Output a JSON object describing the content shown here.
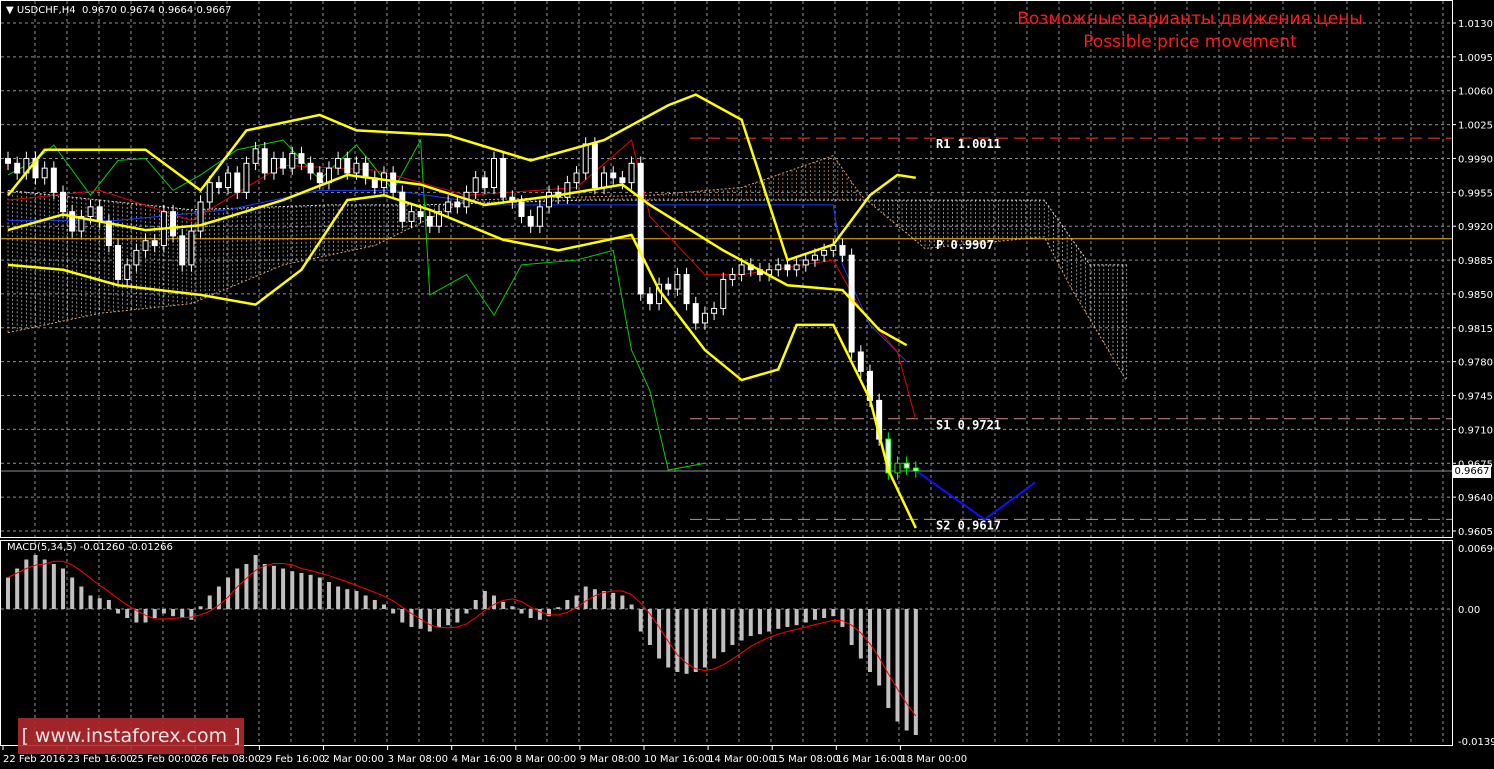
{
  "header": {
    "symbol": "USDCHF,H4",
    "ohlc": "0.9670 0.9674 0.9664 0.9667"
  },
  "annotation": {
    "line1": "Возможные варианты движения цены",
    "line2": "Possible price movement"
  },
  "watermark": "[ www.instaforex.com ]",
  "macd_label": "MACD(5,34,5) -0.01260 -0.01266",
  "current_price": "0.9667",
  "chart_data": [
    {
      "type": "candlestick",
      "symbol": "USDCHF",
      "timeframe": "H4",
      "ylim": [
        0.9605,
        1.013
      ],
      "yticks": [
        "1.0130",
        "1.0095",
        "1.0060",
        "1.0025",
        "0.9990",
        "0.9955",
        "0.9920",
        "0.9885",
        "0.9850",
        "0.9815",
        "0.9780",
        "0.9745",
        "0.9710",
        "0.9675",
        "0.9640",
        "0.9605"
      ],
      "xticks": [
        "22 Feb 2016",
        "23 Feb 16:00",
        "25 Feb 00:00",
        "26 Feb 08:00",
        "29 Feb 16:00",
        "2 Mar 00:00",
        "3 Mar 08:00",
        "4 Mar 16:00",
        "8 Mar 00:00",
        "9 Mar 08:00",
        "10 Mar 16:00",
        "14 Mar 00:00",
        "15 Mar 08:00",
        "16 Mar 16:00",
        "18 Mar 00:00"
      ],
      "close": [
        0.9985,
        0.9975,
        0.999,
        0.997,
        0.998,
        0.9955,
        0.9935,
        0.9915,
        0.993,
        0.994,
        0.9925,
        0.99,
        0.9865,
        0.988,
        0.9895,
        0.9905,
        0.99,
        0.9935,
        0.991,
        0.988,
        0.9915,
        0.9945,
        0.9965,
        0.996,
        0.9975,
        0.9955,
        0.9985,
        1.0,
        0.9975,
        0.999,
        0.998,
        0.9995,
        0.9985,
        0.9975,
        0.9965,
        0.998,
        0.999,
        0.9975,
        0.9985,
        0.997,
        0.996,
        0.9975,
        0.9955,
        0.9925,
        0.9935,
        0.993,
        0.992,
        0.9935,
        0.9945,
        0.994,
        0.9955,
        0.997,
        0.996,
        0.999,
        0.995,
        0.9945,
        0.993,
        0.992,
        0.994,
        0.9955,
        0.995,
        0.9965,
        0.9975,
        1.0005,
        0.996,
        0.9975,
        0.997,
        0.9965,
        0.9985,
        0.985,
        0.984,
        0.986,
        0.9855,
        0.987,
        0.984,
        0.982,
        0.983,
        0.9835,
        0.9865,
        0.987,
        0.988,
        0.9875,
        0.987,
        0.9875,
        0.988,
        0.9875,
        0.988,
        0.9885,
        0.989,
        0.9895,
        0.99,
        0.989,
        0.979,
        0.977,
        0.974,
        0.97,
        0.9665,
        0.9675,
        0.967,
        0.9667
      ],
      "last_ohlc": [
        0.967,
        0.9674,
        0.9664,
        0.9667
      ],
      "bollinger": {
        "upper": [
          [
            0,
            0.9952
          ],
          [
            4,
            0.9999
          ],
          [
            15,
            0.9999
          ],
          [
            21,
            0.9957
          ],
          [
            26,
            1.0019
          ],
          [
            34,
            1.0035
          ],
          [
            38,
            1.0019
          ],
          [
            48,
            1.0014
          ],
          [
            57,
            0.9988
          ],
          [
            65,
            1.0009
          ],
          [
            72,
            1.0045
          ],
          [
            75,
            1.0056
          ],
          [
            80,
            1.003
          ],
          [
            85,
            0.9885
          ],
          [
            90,
            0.9901
          ],
          [
            94,
            0.9952
          ],
          [
            97,
            0.9973
          ],
          [
            99,
            0.997
          ]
        ],
        "middle": [
          [
            0,
            0.9916
          ],
          [
            6,
            0.9932
          ],
          [
            15,
            0.9916
          ],
          [
            21,
            0.9921
          ],
          [
            30,
            0.9947
          ],
          [
            37,
            0.9973
          ],
          [
            45,
            0.9963
          ],
          [
            52,
            0.9942
          ],
          [
            60,
            0.9952
          ],
          [
            67,
            0.9963
          ],
          [
            70,
            0.9942
          ],
          [
            78,
            0.9895
          ],
          [
            85,
            0.9859
          ],
          [
            91,
            0.9854
          ],
          [
            95,
            0.9813
          ],
          [
            98,
            0.9797
          ]
        ],
        "lower": [
          [
            0,
            0.988
          ],
          [
            6,
            0.9875
          ],
          [
            12,
            0.9859
          ],
          [
            21,
            0.9849
          ],
          [
            27,
            0.9839
          ],
          [
            32,
            0.9875
          ],
          [
            37,
            0.9947
          ],
          [
            41,
            0.9952
          ],
          [
            46,
            0.9937
          ],
          [
            54,
            0.9906
          ],
          [
            60,
            0.9895
          ],
          [
            68,
            0.9911
          ],
          [
            71,
            0.9854
          ],
          [
            76,
            0.9792
          ],
          [
            80,
            0.9761
          ],
          [
            84,
            0.9772
          ],
          [
            86,
            0.9818
          ],
          [
            90,
            0.9818
          ],
          [
            94,
            0.9741
          ],
          [
            96,
            0.9668
          ],
          [
            99,
            0.9608
          ]
        ]
      },
      "ichimoku": {
        "tenkan": [
          [
            0,
            0.9947
          ],
          [
            10,
            0.9957
          ],
          [
            20,
            0.9926
          ],
          [
            30,
            0.9983
          ],
          [
            40,
            0.9978
          ],
          [
            50,
            0.9952
          ],
          [
            62,
            0.996
          ],
          [
            68,
            1.0009
          ],
          [
            70,
            0.993
          ],
          [
            76,
            0.987
          ],
          [
            80,
            0.987
          ],
          [
            90,
            0.9885
          ],
          [
            93,
            0.9834
          ],
          [
            97,
            0.979
          ],
          [
            99,
            0.972
          ]
        ],
        "kijun": [
          [
            0,
            0.9926
          ],
          [
            12,
            0.9926
          ],
          [
            24,
            0.9937
          ],
          [
            34,
            0.9957
          ],
          [
            42,
            0.9957
          ],
          [
            53,
            0.9942
          ],
          [
            66,
            0.9942
          ],
          [
            76,
            0.9942
          ],
          [
            90,
            0.9942
          ],
          [
            91,
            0.988
          ],
          [
            94,
            0.9818
          ],
          [
            98,
            0.978
          ]
        ],
        "chikou": [
          [
            0,
            0.9973
          ],
          [
            3,
            0.9988
          ],
          [
            5,
            1.0004
          ],
          [
            9,
            0.9952
          ],
          [
            12,
            0.9988
          ],
          [
            15,
            0.999
          ],
          [
            18,
            0.9957
          ],
          [
            21,
            0.9973
          ],
          [
            25,
            0.9999
          ],
          [
            30,
            1.0009
          ],
          [
            34,
            0.9968
          ],
          [
            38,
            1.0004
          ],
          [
            42,
            0.9957
          ],
          [
            45,
            1.0009
          ],
          [
            46,
            0.9849
          ],
          [
            50,
            0.987
          ],
          [
            53,
            0.9828
          ],
          [
            56,
            0.988
          ],
          [
            62,
            0.9885
          ],
          [
            66,
            0.9895
          ],
          [
            68,
            0.9792
          ],
          [
            70,
            0.975
          ],
          [
            72,
            0.9668
          ],
          [
            76,
            0.9675
          ]
        ],
        "cloud_top": [
          [
            0,
            0.9957
          ],
          [
            20,
            0.9937
          ],
          [
            35,
            0.9942
          ],
          [
            45,
            0.9942
          ],
          [
            63,
            0.9947
          ],
          [
            80,
            0.9947
          ],
          [
            95,
            0.9947
          ],
          [
            113,
            0.9947
          ],
          [
            118,
            0.988
          ],
          [
            122,
            0.988
          ]
        ],
        "cloud_bottom": [
          [
            0,
            0.981
          ],
          [
            10,
            0.983
          ],
          [
            20,
            0.984
          ],
          [
            30,
            0.988
          ],
          [
            40,
            0.99
          ],
          [
            50,
            0.9947
          ],
          [
            70,
            0.9952
          ],
          [
            80,
            0.996
          ],
          [
            90,
            0.9993
          ],
          [
            93,
            0.9952
          ],
          [
            100,
            0.9897
          ],
          [
            113,
            0.9909
          ],
          [
            116,
            0.9855
          ],
          [
            122,
            0.976
          ]
        ]
      },
      "pivot_levels": [
        {
          "label": "R1",
          "value": "1.0011",
          "color": "#ff3b1a",
          "style": "dashed"
        },
        {
          "label": "P",
          "value": "0.9907",
          "color": "#ffb400",
          "style": "solid"
        },
        {
          "label": "S1",
          "value": "0.9721",
          "color": "#d08a8a",
          "style": "dashed"
        },
        {
          "label": "S2",
          "value": "0.9617",
          "color": "#d08a8a",
          "style": "dashed"
        }
      ],
      "forecast_path": [
        [
          99.2,
          0.9666
        ],
        [
          106.5,
          0.9617
        ],
        [
          112,
          0.9655
        ]
      ],
      "forecast_color": "#1010ff"
    },
    {
      "type": "bar",
      "indicator": "MACD(5,34,5)",
      "ylim": [
        -0.01398,
        0.00696
      ],
      "yticks": [
        "0.00696",
        "0.00",
        "-0.01398"
      ],
      "histogram": [
        0.0035,
        0.0045,
        0.0055,
        0.006,
        0.0055,
        0.005,
        0.0045,
        0.0035,
        0.0025,
        0.0015,
        0.0012,
        0.001,
        -0.0005,
        -0.001,
        -0.0015,
        -0.0015,
        -0.001,
        -0.0005,
        -0.0008,
        -0.001,
        -0.0012,
        0.0003,
        0.0015,
        0.0025,
        0.0035,
        0.0045,
        0.005,
        0.006,
        0.005,
        0.0048,
        0.0045,
        0.0042,
        0.004,
        0.0038,
        0.0035,
        0.003,
        0.0025,
        0.0022,
        0.002,
        0.0015,
        0.001,
        0.0005,
        -0.0005,
        -0.0015,
        -0.002,
        -0.0022,
        -0.0025,
        -0.002,
        -0.0018,
        -0.0015,
        -0.0005,
        0.001,
        0.002,
        0.0015,
        0.0008,
        0.0003,
        -0.0005,
        -0.001,
        -0.0012,
        -0.0008,
        0.0002,
        0.001,
        0.0015,
        0.0025,
        0.0022,
        0.002,
        0.0018,
        0.0015,
        0.0005,
        -0.0025,
        -0.004,
        -0.0055,
        -0.0065,
        -0.007,
        -0.0072,
        -0.007,
        -0.0065,
        -0.0055,
        -0.0048,
        -0.004,
        -0.0035,
        -0.003,
        -0.0028,
        -0.0025,
        -0.0022,
        -0.002,
        -0.0018,
        -0.0015,
        -0.0012,
        -0.001,
        -0.0008,
        -0.002,
        -0.004,
        -0.0055,
        -0.007,
        -0.0085,
        -0.011,
        -0.0125,
        -0.0135,
        -0.014
      ],
      "main_value": "-0.01260",
      "signal_value": "-0.01266"
    }
  ]
}
